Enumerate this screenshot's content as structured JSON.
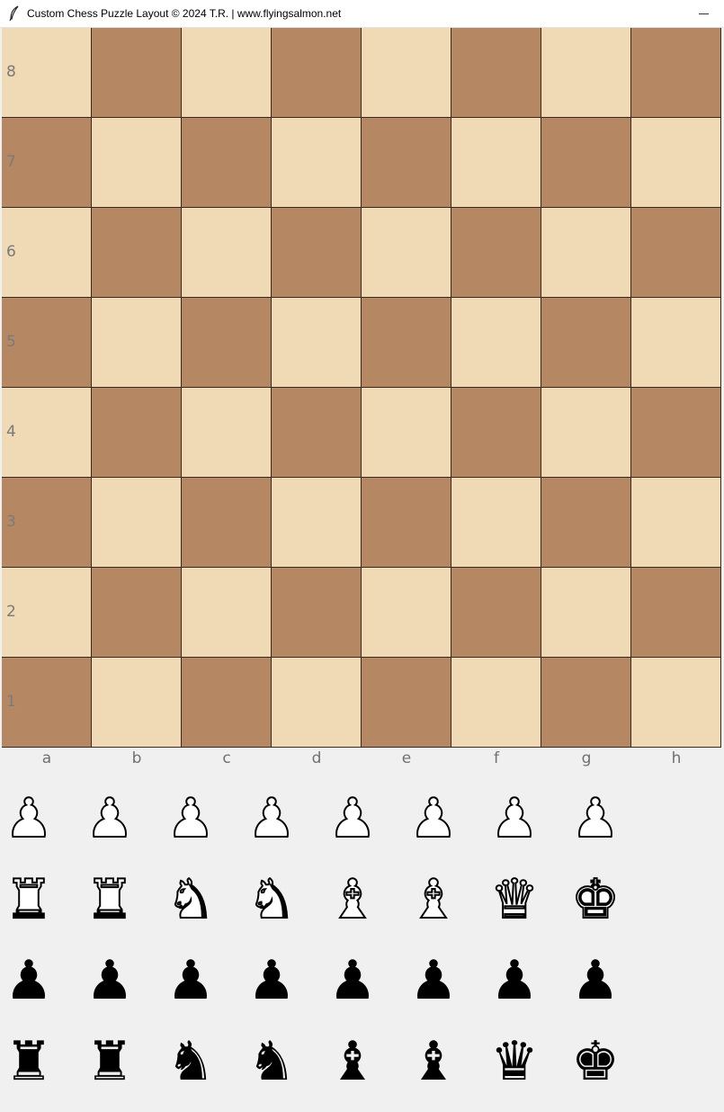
{
  "window": {
    "title": "Custom Chess Puzzle Layout © 2024 T.R. | www.flyingsalmon.net",
    "icon": "feather-icon"
  },
  "board": {
    "light_color": "#f0dab5",
    "dark_color": "#b58863",
    "ranks": [
      "8",
      "7",
      "6",
      "5",
      "4",
      "3",
      "2",
      "1"
    ],
    "files": [
      "a",
      "b",
      "c",
      "d",
      "e",
      "f",
      "g",
      "h"
    ]
  },
  "tray": {
    "rows": [
      {
        "name": "white-pawns",
        "color": "white",
        "pieces": [
          "♟",
          "♟",
          "♟",
          "♟",
          "♟",
          "♟",
          "♟",
          "♟"
        ],
        "kinds": [
          "pawn",
          "pawn",
          "pawn",
          "pawn",
          "pawn",
          "pawn",
          "pawn",
          "pawn"
        ]
      },
      {
        "name": "white-pieces",
        "color": "white",
        "pieces": [
          "♜",
          "♜",
          "♞",
          "♞",
          "♝",
          "♝",
          "♛",
          "♚"
        ],
        "kinds": [
          "rook",
          "rook",
          "knight",
          "knight",
          "bishop",
          "bishop",
          "queen",
          "king"
        ]
      },
      {
        "name": "black-pawns",
        "color": "black",
        "pieces": [
          "♟",
          "♟",
          "♟",
          "♟",
          "♟",
          "♟",
          "♟",
          "♟"
        ],
        "kinds": [
          "pawn",
          "pawn",
          "pawn",
          "pawn",
          "pawn",
          "pawn",
          "pawn",
          "pawn"
        ]
      },
      {
        "name": "black-pieces",
        "color": "black",
        "pieces": [
          "♜",
          "♜",
          "♞",
          "♞",
          "♝",
          "♝",
          "♛",
          "♚"
        ],
        "kinds": [
          "rook",
          "rook",
          "knight",
          "knight",
          "bishop",
          "bishop",
          "queen",
          "king"
        ]
      }
    ]
  }
}
